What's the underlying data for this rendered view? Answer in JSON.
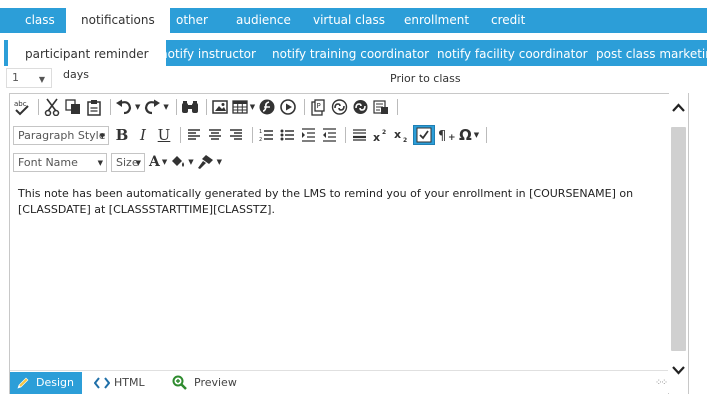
{
  "main_tabs": [
    {
      "label": "class"
    },
    {
      "label": "notifications"
    },
    {
      "label": "other"
    },
    {
      "label": "audience"
    },
    {
      "label": "virtual class"
    },
    {
      "label": "enrollment"
    },
    {
      "label": "credit"
    }
  ],
  "active_main_tab": "notifications",
  "sub_tabs": [
    {
      "label": "participant reminder"
    },
    {
      "label": "notify instructor"
    },
    {
      "label": "notify training coordinator"
    },
    {
      "label": "notify facility coordinator"
    },
    {
      "label": "post class marketing"
    }
  ],
  "active_sub_tab": "participant reminder",
  "reminder": {
    "days_value": "1",
    "days_label": "days",
    "prior_label": "Prior to class"
  },
  "toolbar": {
    "paragraph_style": "Paragraph Style",
    "font_name": "Font Name",
    "size": "Size"
  },
  "editor": {
    "body_text": "This note has been automatically generated by the LMS to remind you of your enrollment in [COURSENAME] on [CLASSDATE] at [CLASSSTARTTIME][CLASSTZ]."
  },
  "modes": [
    {
      "label": "Design"
    },
    {
      "label": "HTML"
    },
    {
      "label": "Preview"
    }
  ],
  "colors": {
    "accent": "#2c9ed8",
    "border": "#c8c8c8",
    "scroll_track": "#d0d0d0"
  }
}
